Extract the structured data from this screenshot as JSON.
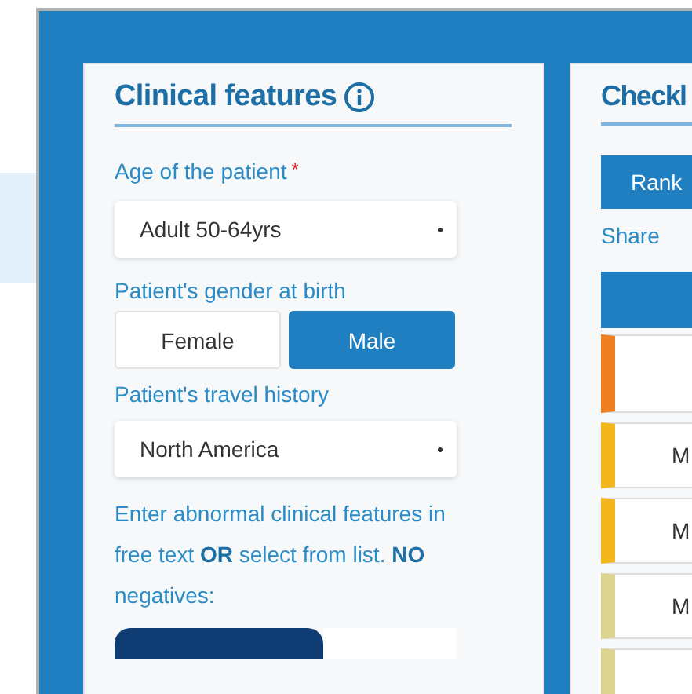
{
  "left_panel": {
    "title": "Clinical features",
    "age": {
      "label": "Age of the patient",
      "required_mark": "*",
      "value": "Adult 50-64yrs"
    },
    "gender": {
      "label": "Patient's gender at birth",
      "options": [
        {
          "label": "Female",
          "selected": false
        },
        {
          "label": "Male",
          "selected": true
        }
      ]
    },
    "travel": {
      "label": "Patient's travel history",
      "value": "North America"
    },
    "instructions": "Enter abnormal clinical features in free text **OR** select from list. **NO** negatives:"
  },
  "right_panel": {
    "title": "Checkl",
    "rank_button": "Rank",
    "share_link": "Share",
    "rows": [
      {
        "color": "#ef7d22"
      },
      {
        "color": "#f3b61c",
        "text": "M"
      },
      {
        "color": "#f3b61c",
        "text": "M"
      },
      {
        "color": "#dcd48e",
        "text": "M"
      },
      {
        "color": "#dcd48e"
      }
    ]
  }
}
